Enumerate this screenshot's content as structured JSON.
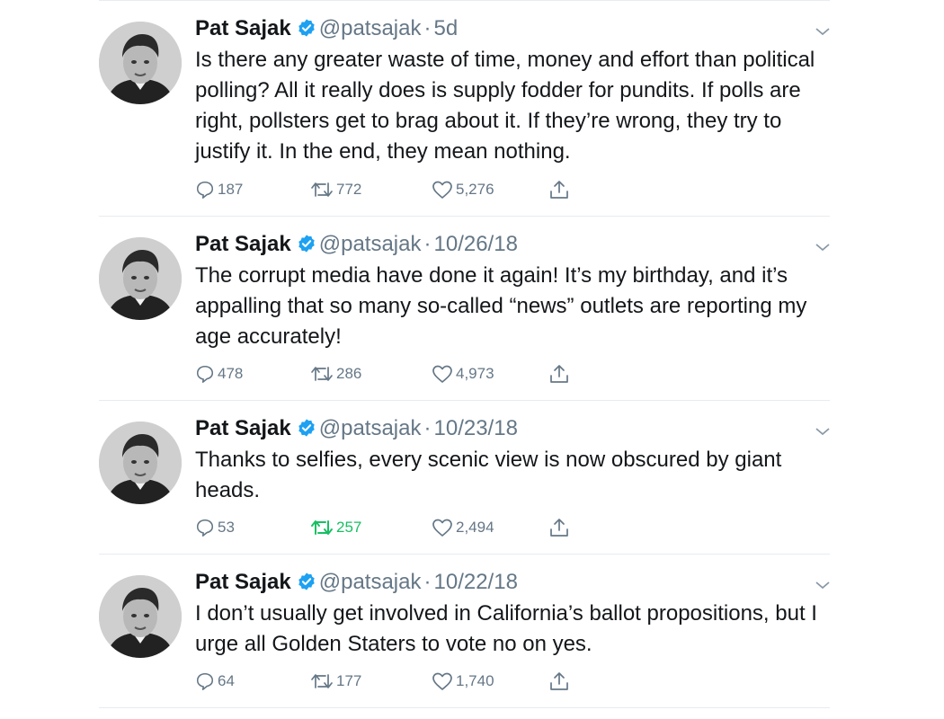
{
  "tweets": [
    {
      "name": "Pat Sajak",
      "handle": "@patsajak",
      "time": "5d",
      "text": "Is there any greater waste of time, money and effort than political polling? All it really does is supply fodder for pundits. If polls are right, pollsters get to brag about it. If they’re wrong, they try to justify it. In the end, they mean nothing.",
      "replies": "187",
      "retweets": "772",
      "likes": "5,276",
      "retweeted": false
    },
    {
      "name": "Pat Sajak",
      "handle": "@patsajak",
      "time": "10/26/18",
      "text": "The corrupt media have done it again! It’s my birthday, and it’s appalling that so many so-called “news” outlets are reporting my age accurately!",
      "replies": "478",
      "retweets": "286",
      "likes": "4,973",
      "retweeted": false
    },
    {
      "name": "Pat Sajak",
      "handle": "@patsajak",
      "time": "10/23/18",
      "text": "Thanks to selfies, every scenic view is now obscured by giant heads.",
      "replies": "53",
      "retweets": "257",
      "likes": "2,494",
      "retweeted": true
    },
    {
      "name": "Pat Sajak",
      "handle": "@patsajak",
      "time": "10/22/18",
      "text": "I don’t usually get involved in California’s ballot propositions, but I urge all Golden Staters to vote no on yes.",
      "replies": "64",
      "retweets": "177",
      "likes": "1,740",
      "retweeted": false
    }
  ],
  "separator": "·",
  "icons": {
    "verified": "verified-badge-icon",
    "menu": "chevron-down-icon",
    "reply": "reply-icon",
    "retweet": "retweet-icon",
    "like": "heart-icon",
    "share": "share-icon"
  },
  "colors": {
    "text": "#14171a",
    "secondary": "#657786",
    "verified": "#1da1f2",
    "retweet_active": "#17bf63",
    "divider": "#e6ecf0"
  }
}
